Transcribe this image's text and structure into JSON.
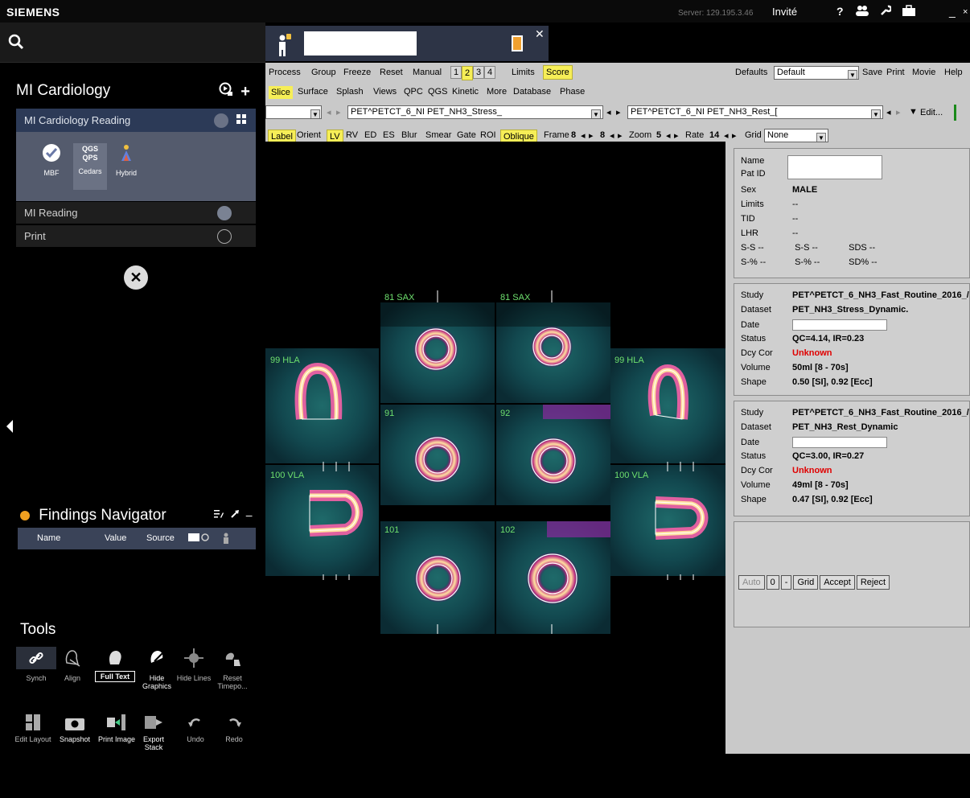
{
  "topbar": {
    "brand": "SIEMENS",
    "server": "Server: 129.195.3.46",
    "user": "Invité",
    "icons": [
      "help-icon",
      "users-icon",
      "wrench-icon",
      "briefcase-icon",
      "minimize-icon",
      "close-icon"
    ]
  },
  "sidebar": {
    "search_icon": "search-icon",
    "title": "MI Cardiology",
    "workflow": {
      "header": "MI Cardiology Reading",
      "apps": [
        {
          "label": "MBF",
          "icon": "check-circle-icon",
          "selected": false
        },
        {
          "label": "Cedars",
          "icon": "qgs-qps-icon",
          "selected": true
        },
        {
          "label": "Hybrid",
          "icon": "hybrid-icon",
          "selected": false
        }
      ],
      "rows": [
        "MI Reading",
        "Print"
      ]
    },
    "findings": {
      "title": "Findings Navigator",
      "columns": [
        "Name",
        "Value",
        "Source"
      ]
    },
    "tools": {
      "title": "Tools",
      "row1": [
        {
          "label": "Synch",
          "icon": "link-icon",
          "on": true
        },
        {
          "label": "Align",
          "icon": "align-icon",
          "on": false
        },
        {
          "label": "Full Text",
          "icon": "head-icon",
          "on": false
        },
        {
          "label": "Hide Graphics",
          "icon": "hide-graphics-icon",
          "on": false
        },
        {
          "label": "Hide Lines",
          "icon": "crosshair-icon",
          "on": false
        },
        {
          "label": "Reset Timepo...",
          "icon": "reset-icon",
          "on": false
        }
      ],
      "row2": [
        {
          "label": "Edit Layout",
          "icon": "layout-icon",
          "on": false
        },
        {
          "label": "Snapshot",
          "icon": "camera-icon",
          "on": false
        },
        {
          "label": "Print Image",
          "icon": "print-image-icon",
          "on": false
        },
        {
          "label": "Export Stack",
          "icon": "export-icon",
          "on": false
        },
        {
          "label": "Undo",
          "icon": "undo-icon",
          "on": false
        },
        {
          "label": "Redo",
          "icon": "redo-icon",
          "on": false
        }
      ]
    }
  },
  "qpanel": {
    "row1": {
      "items": [
        "Process",
        "Group",
        "Freeze",
        "Reset",
        "Manual"
      ],
      "pages": [
        "1",
        "2",
        "3",
        "4"
      ],
      "limits": "Limits",
      "score": "Score",
      "defaults_label": "Defaults",
      "defaults_value": "Default",
      "right": [
        "Save",
        "Print",
        "Movie",
        "Help"
      ]
    },
    "row2": [
      "Slice",
      "Surface",
      "Splash",
      "Views",
      "QPC",
      "QGS",
      "Kinetic",
      "More",
      "Database",
      "Phase"
    ],
    "row3": {
      "stress_dataset": "PET^PETCT_6_NI PET_NH3_Stress_",
      "rest_dataset": "PET^PETCT_6_NI PET_NH3_Rest_[",
      "edit": "Edit..."
    },
    "row4": {
      "items": [
        "Label",
        "Orient",
        "LV",
        "RV",
        "ED",
        "ES",
        "Blur",
        "Smear",
        "Gate",
        "ROI",
        "Oblique"
      ],
      "frame_label": "Frame",
      "frame_a": "8",
      "frame_b": "8",
      "zoom_label": "Zoom",
      "zoom": "5",
      "rate_label": "Rate",
      "rate": "14",
      "grid_label": "Grid",
      "grid": "None"
    }
  },
  "viewer": {
    "tiles": [
      "81 SAX",
      "81 SAX",
      "99 HLA",
      "99 HLA",
      "91",
      "92",
      "100 VLA",
      "100 VLA",
      "101",
      "102"
    ]
  },
  "info": {
    "patient": {
      "name_label": "Name",
      "patid_label": "Pat ID",
      "sex_label": "Sex",
      "sex": "MALE",
      "limits_label": "Limits",
      "limits": "--",
      "tid_label": "TID",
      "tid": "--",
      "lhr_label": "LHR",
      "lhr": "--",
      "ss1": "S-S  --",
      "ss2": "S-S  --",
      "sds": "SDS --",
      "sp1": "S-%  --",
      "sp2": "S-%  --",
      "sdp": "SD% --"
    },
    "stress": {
      "study_label": "Study",
      "study": "PET^PETCT_6_NH3_Fast_Routine_2016_/",
      "dataset_label": "Dataset",
      "dataset": "PET_NH3_Stress_Dynamic.",
      "date_label": "Date",
      "status_label": "Status",
      "status": "QC=4.14, IR=0.23",
      "dcy_label": "Dcy Cor",
      "dcy": "Unknown",
      "volume_label": "Volume",
      "volume": "50ml [8 - 70s]",
      "shape_label": "Shape",
      "shape": "0.50 [SI],  0.92 [Ecc]"
    },
    "rest": {
      "study_label": "Study",
      "study": "PET^PETCT_6_NH3_Fast_Routine_2016_/",
      "dataset_label": "Dataset",
      "dataset": "PET_NH3_Rest_Dynamic",
      "date_label": "Date",
      "status_label": "Status",
      "status": "QC=3.00, IR=0.27",
      "dcy_label": "Dcy Cor",
      "dcy": "Unknown",
      "volume_label": "Volume",
      "volume": "49ml [8 - 70s]",
      "shape_label": "Shape",
      "shape": "0.47 [SI],  0.92 [Ecc]"
    },
    "buttons": [
      "Auto",
      "0",
      "-",
      "Grid",
      "Accept",
      "Reject"
    ]
  },
  "colors": {
    "accent_yellow": "#f6ee57",
    "panel_gray": "#c9c9c9",
    "workflow_blue": "#2c3a57",
    "label_green": "#6ee06e",
    "alert_red": "#e00000"
  }
}
